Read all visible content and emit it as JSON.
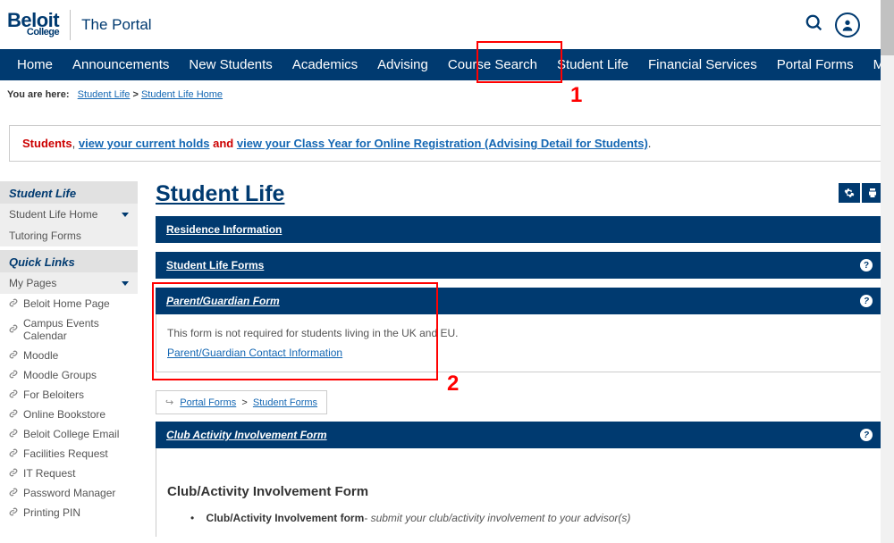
{
  "logo": {
    "name": "Beloit",
    "sub": "College",
    "portal": "The Portal"
  },
  "nav": {
    "items": [
      "Home",
      "Announcements",
      "New Students",
      "Academics",
      "Advising",
      "Course Search",
      "Student Life",
      "Financial Services",
      "Portal Forms",
      "More"
    ],
    "highlighted_index": 6
  },
  "breadcrumb": {
    "prefix": "You are here:",
    "link1": "Student Life",
    "link2": "Student Life Home"
  },
  "callouts": {
    "one": "1",
    "two": "2"
  },
  "notice": {
    "students": "Students",
    "comma": ", ",
    "link1": "view your current holds",
    "and": " and ",
    "link2": "view your Class Year for Online Registration (Advising Detail for Students)",
    "period": "."
  },
  "sidebar": {
    "section1_title": "Student Life",
    "section1": [
      {
        "label": "Student Life Home",
        "expandable": true
      },
      {
        "label": "Tutoring Forms",
        "expandable": false
      }
    ],
    "section2_title": "Quick Links",
    "section2_head": {
      "label": "My Pages",
      "expandable": true
    },
    "links": [
      "Beloit Home Page",
      "Campus Events Calendar",
      "Moodle",
      "Moodle Groups",
      "For Beloiters",
      "Online Bookstore",
      "Beloit College Email",
      "Facilities Request",
      "IT Request",
      "Password Manager",
      "Printing PIN"
    ]
  },
  "main": {
    "title": "Student Life",
    "cards": {
      "residence": {
        "title": "Residence Information"
      },
      "student_forms": {
        "title": "Student Life Forms"
      },
      "parent": {
        "title": "Parent/Guardian Form",
        "body_text": "This form is not required for students living in the UK and EU.",
        "link": "Parent/Guardian Contact Information"
      },
      "club": {
        "title": "Club Activity Involvement Form"
      }
    },
    "mini_breadcrumb": {
      "link1": "Portal Forms",
      "link2": "Student Forms"
    },
    "form_section_title": "Club/Activity Involvement Form",
    "bullet": {
      "bold": "Club/Activity Involvement form",
      "rest": "- submit your club/activity involvement to your advisor(s)"
    }
  }
}
